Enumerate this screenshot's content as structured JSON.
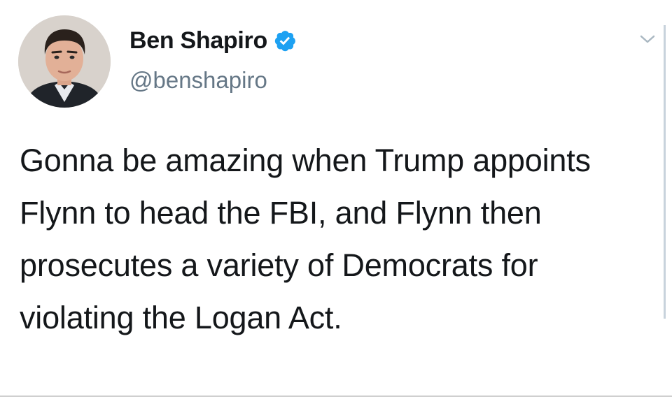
{
  "tweet": {
    "display_name": "Ben Shapiro",
    "handle": "@benshapiro",
    "verified": true,
    "text": "Gonna be amazing when Trump appoints Flynn to head the FBI, and Flynn then prosecutes a variety of Democrats for violating the Logan Act."
  },
  "icons": {
    "verified": "verified-badge-icon",
    "menu": "chevron-down-icon"
  },
  "colors": {
    "verified_blue": "#1da1f2",
    "handle_gray": "#657786",
    "text_dark": "#14171a"
  }
}
